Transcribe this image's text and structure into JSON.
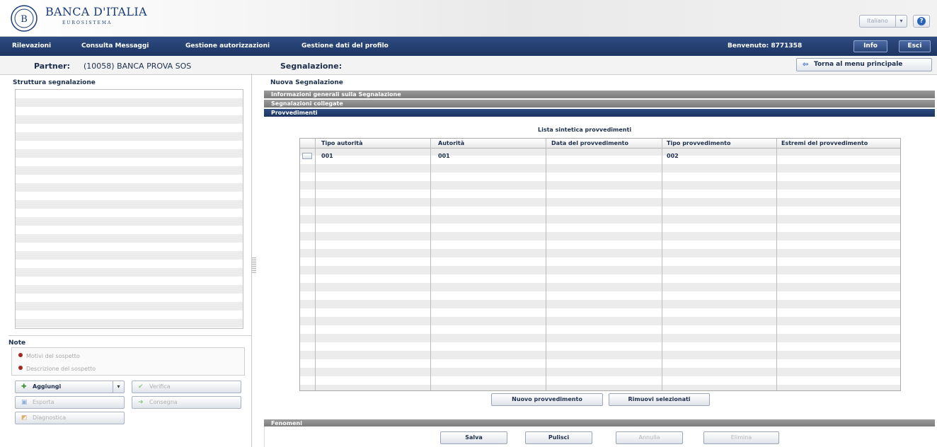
{
  "header": {
    "bank_name": "BANCA D'ITALIA",
    "bank_subtitle": "EUROSISTEMA",
    "language": "Italiano"
  },
  "nav": {
    "items": [
      "Rilevazioni",
      "Consulta Messaggi",
      "Gestione autorizzazioni",
      "Gestione dati del profilo"
    ],
    "welcome": "Benvenuto:  8771358",
    "info_label": "Info",
    "exit_label": "Esci"
  },
  "partner_bar": {
    "partner_label": "Partner:",
    "partner_value": "(10058) BANCA PROVA SOS",
    "segnalazione_label": "Segnalazione:",
    "back_button": "Torna al menu principale"
  },
  "left": {
    "title": "Struttura segnalazione",
    "notes_label": "Note",
    "notes": [
      "Motivi del sospetto",
      "Descrizione del sospetto"
    ],
    "buttons": {
      "add": "Aggiungi",
      "verify": "Verifica",
      "export": "Esporta",
      "deliver": "Consegna",
      "diagnostics": "Diagnostica"
    }
  },
  "right": {
    "title": "Nuova Segnalazione",
    "sections": {
      "general": "Informazioni generali sulla Segnalazione",
      "linked": "Segnalazioni collegate",
      "measures": "Provvedimenti",
      "phenomena": "Fenomeni"
    },
    "list_title": "Lista sintetica provvedimenti",
    "columns": [
      "Tipo autorità",
      "Autorità",
      "Data del provvedimento",
      "Tipo provvedimento",
      "Estremi del provvedimento"
    ],
    "rows": [
      [
        "001",
        "001",
        "",
        "002",
        ""
      ]
    ],
    "new_measure_button": "Nuovo provvedimento",
    "remove_selected_button": "Rimuovi selezionati",
    "bottom_buttons": {
      "save": "Salva",
      "clear": "Pulisci",
      "cancel": "Annulla",
      "delete": "Elimina"
    }
  },
  "colors": {
    "nav_bg": "#1c3461",
    "section_grey": "#8a8a8a",
    "section_active": "#1c3461",
    "brand_text": "#1a3c77"
  },
  "icons": [
    "bank-logo-icon",
    "help-icon",
    "back-arrow-icon",
    "add-icon",
    "check-icon",
    "export-icon",
    "deliver-icon",
    "diagnostics-icon"
  ]
}
